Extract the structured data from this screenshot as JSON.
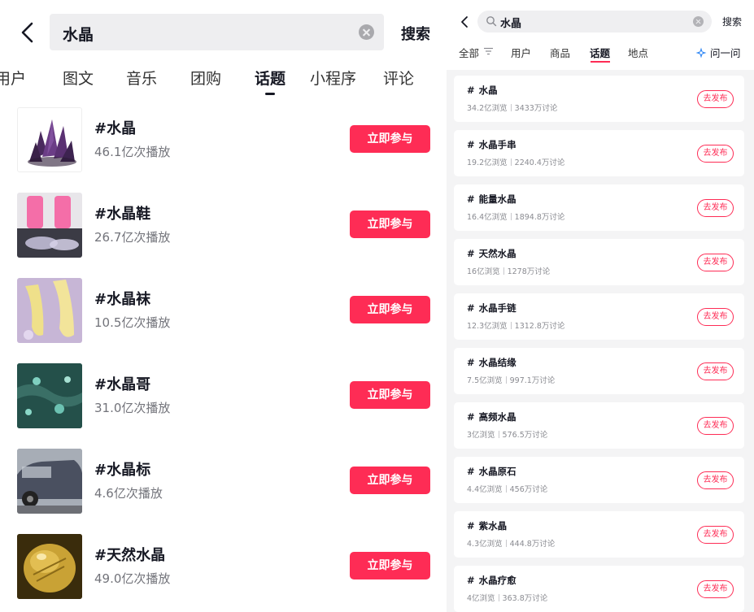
{
  "left": {
    "search": {
      "query": "水晶",
      "button_label": "搜索"
    },
    "tabs": [
      {
        "label": "用户"
      },
      {
        "label": "图文"
      },
      {
        "label": "音乐"
      },
      {
        "label": "团购"
      },
      {
        "label": "话题",
        "active": true
      },
      {
        "label": "小程序"
      },
      {
        "label": "评论"
      }
    ],
    "join_label": "立即参与",
    "items": [
      {
        "title": "#水晶",
        "plays": "46.1亿次播放"
      },
      {
        "title": "#水晶鞋",
        "plays": "26.7亿次播放"
      },
      {
        "title": "#水晶袜",
        "plays": "10.5亿次播放"
      },
      {
        "title": "#水晶哥",
        "plays": "31.0亿次播放"
      },
      {
        "title": "#水晶标",
        "plays": "4.6亿次播放"
      },
      {
        "title": "#天然水晶",
        "plays": "49.0亿次播放"
      }
    ]
  },
  "right": {
    "search": {
      "query": "水晶",
      "button_label": "搜索"
    },
    "tabs": [
      {
        "label": "全部"
      },
      {
        "label": "用户"
      },
      {
        "label": "商品"
      },
      {
        "label": "话题",
        "active": true
      },
      {
        "label": "地点"
      }
    ],
    "ask_label": "问一问",
    "publish_label": "去发布",
    "hash": "#",
    "topics": [
      {
        "name": "水晶",
        "views": "34.2亿浏览",
        "discussions": "3433万讨论"
      },
      {
        "name": "水晶手串",
        "views": "19.2亿浏览",
        "discussions": "2240.4万讨论"
      },
      {
        "name": "能量水晶",
        "views": "16.4亿浏览",
        "discussions": "1894.8万讨论"
      },
      {
        "name": "天然水晶",
        "views": "16亿浏览",
        "discussions": "1278万讨论"
      },
      {
        "name": "水晶手链",
        "views": "12.3亿浏览",
        "discussions": "1312.8万讨论"
      },
      {
        "name": "水晶结缘",
        "views": "7.5亿浏览",
        "discussions": "997.1万讨论"
      },
      {
        "name": "高频水晶",
        "views": "3亿浏览",
        "discussions": "576.5万讨论"
      },
      {
        "name": "水晶原石",
        "views": "4.4亿浏览",
        "discussions": "456万讨论"
      },
      {
        "name": "紫水晶",
        "views": "4.3亿浏览",
        "discussions": "444.8万讨论"
      },
      {
        "name": "水晶疗愈",
        "views": "4亿浏览",
        "discussions": "363.8万讨论"
      }
    ]
  },
  "colors": {
    "accent": "#fe2c55",
    "text": "#161823",
    "muted": "#72737a"
  }
}
